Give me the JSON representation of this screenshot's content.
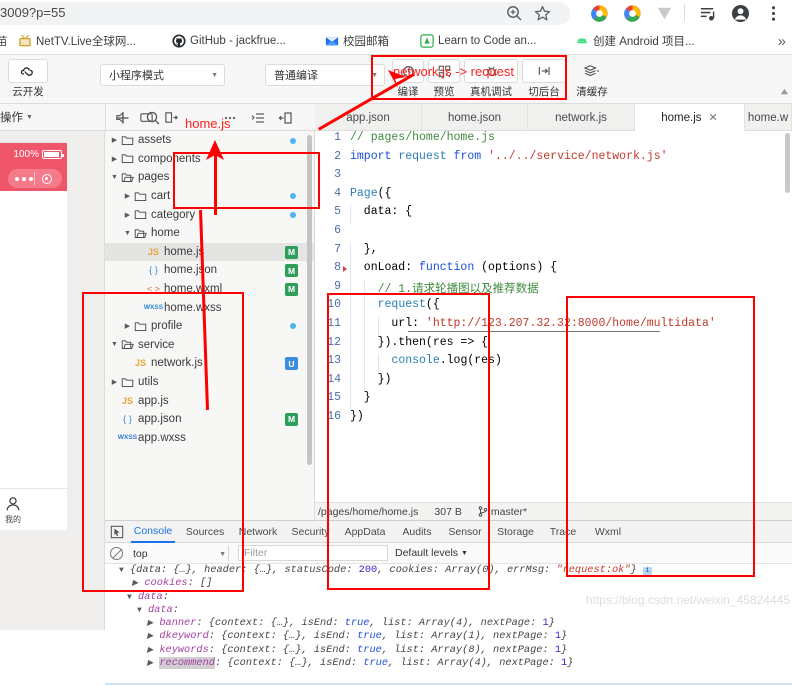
{
  "browser": {
    "url_text": "3009?p=55",
    "omnibox_icons": [
      "zoom-icon",
      "star-icon"
    ],
    "toolbar_icons": [
      "chrome-profile-circle-icon",
      "chrome-profile-circle-icon-2",
      "download-chevron-icon",
      "reading-list-icon",
      "account-avatar-icon",
      "chrome-menu-icon"
    ],
    "bookmarks": [
      {
        "label": "苗",
        "icon": "generic-site-icon"
      },
      {
        "label": "NetTV.Live全球网...",
        "icon": "tv-icon"
      },
      {
        "label": "GitHub - jackfrue...",
        "icon": "github-icon"
      },
      {
        "label": "校园邮箱",
        "icon": "mail-icon"
      },
      {
        "label": "Learn to Code an...",
        "icon": "codecademy-icon"
      },
      {
        "label": "创建 Android 项目...",
        "icon": "android-icon"
      }
    ],
    "overflow_label": "»"
  },
  "devtools": {
    "toolbar": {
      "cloud_label": "云开发",
      "cloud_icon": "cloud-dev-icon",
      "mode_select": "小程序模式",
      "compile_select": "普通编译",
      "buttons": [
        {
          "label": "编译",
          "icon": "compile-icon"
        },
        {
          "label": "预览",
          "icon": "preview-qr-icon"
        },
        {
          "label": "真机调试",
          "icon": "device-debug-icon"
        },
        {
          "label": "切后台",
          "icon": "background-switch-icon"
        },
        {
          "label": "清缓存",
          "icon": "clear-cache-icon"
        }
      ]
    },
    "file_toolbar": {
      "operation_label": "操作",
      "icons": [
        "speaker-icon",
        "simulator-panel-icon",
        "editor-panel-icon",
        "add-icon",
        "search-icon",
        "more-icon",
        "collapse-all-icon",
        "debug-panel-icon"
      ]
    },
    "simulator": {
      "battery_percent": "100%",
      "tabbar_label": "我的",
      "tabbar_icon": "person-icon"
    },
    "file_tree": [
      {
        "label": "assets",
        "indent": 0,
        "type": "folder",
        "twisty": "collapsed",
        "badge": "",
        "dot": true
      },
      {
        "label": "components",
        "indent": 0,
        "type": "folder",
        "twisty": "collapsed",
        "badge": "",
        "dot": false
      },
      {
        "label": "pages",
        "indent": 0,
        "type": "folder-open",
        "twisty": "expanded",
        "badge": "",
        "dot": false
      },
      {
        "label": "cart",
        "indent": 1,
        "type": "folder",
        "twisty": "collapsed",
        "badge": "",
        "dot": true
      },
      {
        "label": "category",
        "indent": 1,
        "type": "folder",
        "twisty": "collapsed",
        "badge": "",
        "dot": true
      },
      {
        "label": "home",
        "indent": 1,
        "type": "folder-open",
        "twisty": "expanded",
        "badge": "",
        "dot": false
      },
      {
        "label": "home.js",
        "indent": 2,
        "type": "js",
        "twisty": "",
        "badge": "M",
        "dot": false,
        "selected": true
      },
      {
        "label": "home.json",
        "indent": 2,
        "type": "json",
        "twisty": "",
        "badge": "M",
        "dot": false
      },
      {
        "label": "home.wxml",
        "indent": 2,
        "type": "wxml",
        "twisty": "",
        "badge": "M",
        "dot": false
      },
      {
        "label": "home.wxss",
        "indent": 2,
        "type": "wxss",
        "twisty": "",
        "badge": "",
        "dot": false
      },
      {
        "label": "profile",
        "indent": 1,
        "type": "folder",
        "twisty": "collapsed",
        "badge": "",
        "dot": true
      },
      {
        "label": "service",
        "indent": 0,
        "type": "folder-open",
        "twisty": "expanded",
        "badge": "",
        "dot": false
      },
      {
        "label": "network.js",
        "indent": 1,
        "type": "js",
        "twisty": "",
        "badge": "U",
        "dot": false
      },
      {
        "label": "utils",
        "indent": 0,
        "type": "folder",
        "twisty": "collapsed",
        "badge": "",
        "dot": false
      },
      {
        "label": "app.js",
        "indent": 0,
        "type": "js",
        "twisty": "",
        "badge": "",
        "dot": false
      },
      {
        "label": "app.json",
        "indent": 0,
        "type": "json",
        "twisty": "",
        "badge": "M",
        "dot": false
      },
      {
        "label": "app.wxss",
        "indent": 0,
        "type": "wxss",
        "twisty": "",
        "badge": "",
        "dot": false
      }
    ],
    "editor_tabs": [
      {
        "label": "app.json",
        "active": false,
        "closable": false
      },
      {
        "label": "home.json",
        "active": false,
        "closable": false
      },
      {
        "label": "network.js",
        "active": false,
        "closable": false
      },
      {
        "label": "home.js",
        "active": true,
        "closable": true
      },
      {
        "label": "home.w",
        "active": false,
        "closable": false
      }
    ],
    "code_lines": [
      {
        "n": "1",
        "text": "// pages/home/home.js"
      },
      {
        "n": "2",
        "text": "import request from '../../service/network.js'"
      },
      {
        "n": "3",
        "text": ""
      },
      {
        "n": "4",
        "text": "Page({"
      },
      {
        "n": "5",
        "text": "  data: {"
      },
      {
        "n": "6",
        "text": ""
      },
      {
        "n": "7",
        "text": "  },"
      },
      {
        "n": "8",
        "text": "  onLoad: function (options) {"
      },
      {
        "n": "9",
        "text": "    // 1.请求轮播图以及推荐数据"
      },
      {
        "n": "10",
        "text": "    request({"
      },
      {
        "n": "11",
        "text": "      url: 'http://123.207.32.32:8000/home/multidata'"
      },
      {
        "n": "12",
        "text": "    }).then(res => {"
      },
      {
        "n": "13",
        "text": "      console.log(res)"
      },
      {
        "n": "14",
        "text": "    })"
      },
      {
        "n": "15",
        "text": "  }"
      },
      {
        "n": "16",
        "text": "})"
      }
    ],
    "status_bar": {
      "path": "/pages/home/home.js",
      "size": "307 B",
      "branch": "master*",
      "branch_icon": "git-branch-icon"
    },
    "console": {
      "tabs": [
        "Console",
        "Sources",
        "Network",
        "Security",
        "AppData",
        "Audits",
        "Sensor",
        "Storage",
        "Trace",
        "Wxml"
      ],
      "active_tab": "Console",
      "inspect_icon": "inspect-cursor-icon",
      "clear_icon": "clear-console-icon",
      "context": "top",
      "filter_placeholder": "Filter",
      "levels": "Default levels",
      "log_lines": [
        "{data: {…}, header: {…}, statusCode: 200, cookies: Array(0), errMsg: \"request:ok\"}",
        "cookies: []",
        "data:",
        "data:",
        "banner: {context: {…}, isEnd: true, list: Array(4), nextPage: 1}",
        "dkeyword: {context: {…}, isEnd: true, list: Array(1), nextPage: 1}",
        "keywords: {context: {…}, isEnd: true, list: Array(8), nextPage: 1}",
        "recommend: {context: {…}, isEnd: true, list: Array(4), nextPage: 1}"
      ]
    }
  },
  "annotations": {
    "label_home_js": "home.js",
    "label_network_request": "network.js -> request",
    "color": "#ff0000"
  },
  "watermark": "https://blog.csdn.net/weixin_45824445"
}
